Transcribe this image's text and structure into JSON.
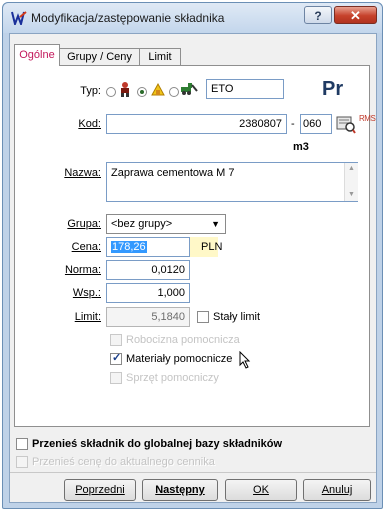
{
  "window": {
    "title": "Modyfikacja/zastępowanie składnika",
    "help_label": "?",
    "close_label": "✕"
  },
  "tabs": [
    {
      "label": "Ogólne"
    },
    {
      "label": "Grupy / Ceny"
    },
    {
      "label": "Limit"
    }
  ],
  "type_row": {
    "label": "Typ:",
    "selected_index": 1,
    "field_value": "ETO",
    "big_label": "Pr"
  },
  "kod": {
    "label": "Kod:",
    "value": "2380807",
    "separator": "-",
    "suffix": "060",
    "unit": "m3",
    "rms_label": "RMS"
  },
  "nazwa": {
    "label": "Nazwa:",
    "value": "Zaprawa cementowa M  7"
  },
  "grupa": {
    "label": "Grupa:",
    "value": "<bez grupy>"
  },
  "cena": {
    "label": "Cena:",
    "value": "178,26",
    "currency": "PLN"
  },
  "norma": {
    "label": "Norma:",
    "value": "0,0120"
  },
  "wsp": {
    "label": "Wsp.:",
    "value": "1,000"
  },
  "limit": {
    "label": "Limit:",
    "value": "5,1840",
    "checkbox_label": "Stały limit"
  },
  "options": [
    {
      "label": "Robocizna pomocnicza",
      "checked": false,
      "disabled": true
    },
    {
      "label": "Materiały pomocnicze",
      "checked": true,
      "disabled": false
    },
    {
      "label": "Sprzęt pomocniczy",
      "checked": false,
      "disabled": true
    }
  ],
  "bottom": {
    "move_label": "Przenieś składnik do globalnej bazy składników",
    "price_label": "Przenieś cenę do aktualnego cennika"
  },
  "buttons": {
    "prev": "Poprzedni",
    "next": "Następny",
    "ok": "OK",
    "cancel": "Anuluj"
  }
}
